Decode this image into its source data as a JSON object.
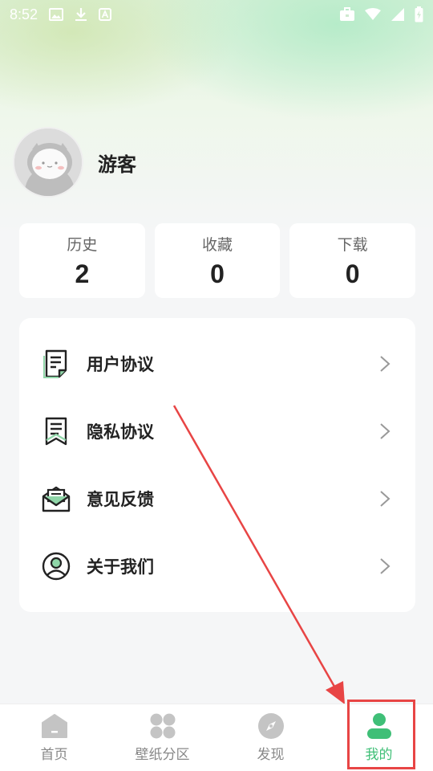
{
  "status_bar": {
    "time": "8:52"
  },
  "profile": {
    "username": "游客"
  },
  "stats": [
    {
      "label": "历史",
      "value": "2"
    },
    {
      "label": "收藏",
      "value": "0"
    },
    {
      "label": "下载",
      "value": "0"
    }
  ],
  "menu": [
    {
      "label": "用户协议",
      "icon": "document-icon"
    },
    {
      "label": "隐私协议",
      "icon": "privacy-document-icon"
    },
    {
      "label": "意见反馈",
      "icon": "envelope-icon"
    },
    {
      "label": "关于我们",
      "icon": "user-circle-icon"
    }
  ],
  "tabbar": {
    "items": [
      {
        "label": "首页",
        "icon": "home-icon"
      },
      {
        "label": "壁纸分区",
        "icon": "grid-icon"
      },
      {
        "label": "发现",
        "icon": "compass-icon"
      },
      {
        "label": "我的",
        "icon": "person-icon"
      }
    ],
    "active_index": 3
  },
  "colors": {
    "accent": "#3fbf77",
    "annotation": "#e84545"
  }
}
